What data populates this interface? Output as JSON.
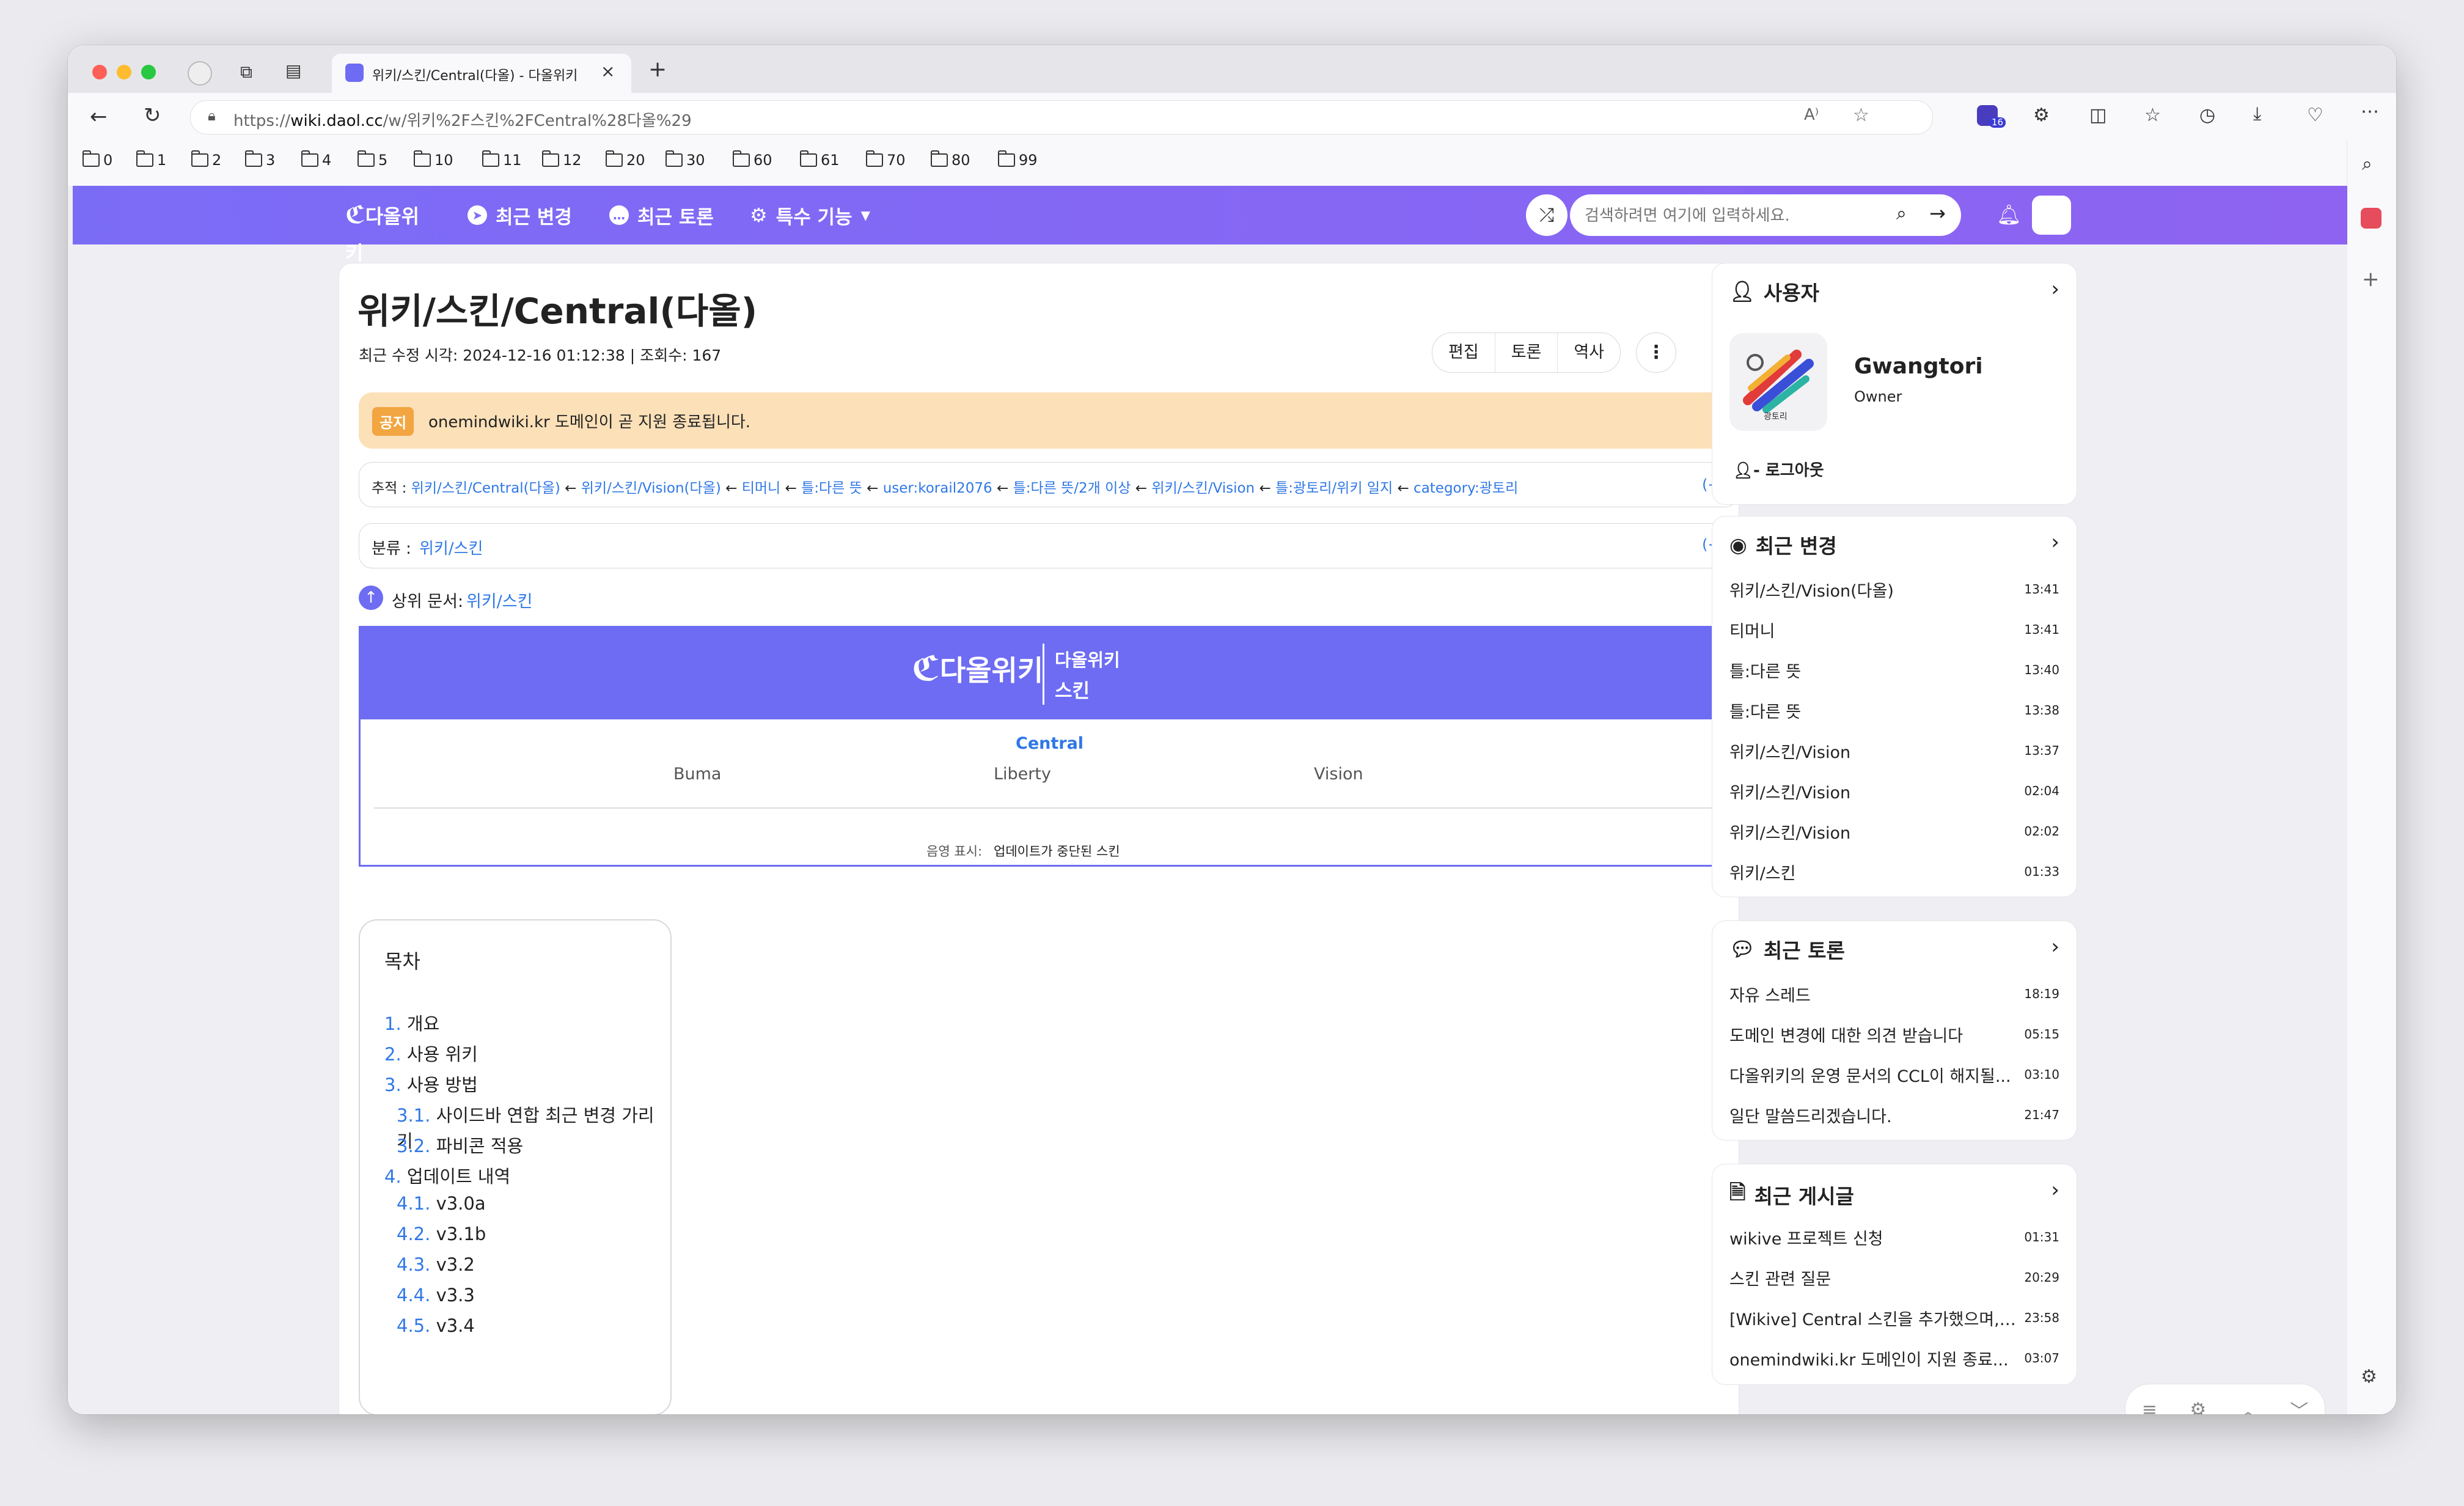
{
  "browser": {
    "tab_title": "위키/스킨/Central(다올) - 다올위키",
    "url_prefix": "https://",
    "url_host": "wiki.daol.cc",
    "url_path": "/w/위키%2F스킨%2FCentral%28다올%29",
    "extensions_badge": "16",
    "bookmarks": [
      "0",
      "1",
      "2",
      "3",
      "4",
      "5",
      "10",
      "11",
      "12",
      "20",
      "30",
      "60",
      "61",
      "70",
      "80",
      "99"
    ]
  },
  "site": {
    "logo_text": "다올위키",
    "nav": [
      "최근 변경",
      "최근 토론",
      "특수 기능"
    ],
    "search_placeholder": "검색하려면 여기에 입력하세요."
  },
  "article": {
    "title": "위키/스킨/Central(다올)",
    "meta": "최근 수정 시각: 2024-12-16 01:12:38 | 조회수: 167",
    "buttons": [
      "편집",
      "토론",
      "역사"
    ],
    "notice_badge": "공지",
    "notice_text": "onemindwiki.kr 도메인이 곧 지원 종료됩니다.",
    "trail_label": "추적 :",
    "trail": [
      "위키/스킨/Central(다올)",
      "위키/스킨/Vision(다올)",
      "티머니",
      "틀:다른 뜻",
      "user:korail2076",
      "틀:다른 뜻/2개 이상",
      "위키/스킨/Vision",
      "틀:광토리/위키 일지",
      "category:광토리"
    ],
    "trail_sep": "←",
    "plus": "(+)",
    "category_label": "분류 :",
    "category": "위키/스킨",
    "parent_label": "상위 문서:",
    "parent_link": "위키/스킨",
    "infobox": {
      "logo": "다올위키",
      "title_line1": "다올위키",
      "title_line2": "스킨",
      "current": "Central",
      "items": [
        "Buma",
        "Liberty",
        "Vision"
      ],
      "footer_label": "음영 표시:",
      "footer_text": "업데이트가 중단된 스킨"
    },
    "toc": {
      "title": "목차",
      "items": [
        {
          "num": "1.",
          "text": "개요"
        },
        {
          "num": "2.",
          "text": "사용 위키"
        },
        {
          "num": "3.",
          "text": "사용 방법"
        },
        {
          "num": "3.1.",
          "text": "사이드바 연합 최근 변경 가리기"
        },
        {
          "num": "3.2.",
          "text": "파비콘 적용"
        },
        {
          "num": "4.",
          "text": "업데이트 내역"
        },
        {
          "num": "4.1.",
          "text": "v3.0a"
        },
        {
          "num": "4.2.",
          "text": "v3.1b"
        },
        {
          "num": "4.3.",
          "text": "v3.2"
        },
        {
          "num": "4.4.",
          "text": "v3.3"
        },
        {
          "num": "4.5.",
          "text": "v3.4"
        }
      ]
    }
  },
  "sidebar": {
    "user": {
      "heading": "사용자",
      "name": "Gwangtori",
      "role": "Owner",
      "avatar_caption": "광토리",
      "logout": "로그아웃"
    },
    "recent_changes": {
      "heading": "최근 변경",
      "items": [
        {
          "t": "위키/스킨/Vision(다올)",
          "tm": "13:41"
        },
        {
          "t": "티머니",
          "tm": "13:41"
        },
        {
          "t": "틀:다른 뜻",
          "tm": "13:40"
        },
        {
          "t": "틀:다른 뜻",
          "tm": "13:38"
        },
        {
          "t": "위키/스킨/Vision",
          "tm": "13:37"
        },
        {
          "t": "위키/스킨/Vision",
          "tm": "02:04"
        },
        {
          "t": "위키/스킨/Vision",
          "tm": "02:02"
        },
        {
          "t": "위키/스킨",
          "tm": "01:33"
        }
      ]
    },
    "recent_discussions": {
      "heading": "최근 토론",
      "items": [
        {
          "t": "자유 스레드",
          "tm": "18:19"
        },
        {
          "t": "도메인 변경에 대한 의견 받습니다",
          "tm": "05:15"
        },
        {
          "t": "다올위키의 운영 문서의 CCL이 해지될...",
          "tm": "03:10"
        },
        {
          "t": "일단 말씀드리겠습니다.",
          "tm": "21:47"
        }
      ]
    },
    "recent_posts": {
      "heading": "최근 게시글",
      "items": [
        {
          "t": "wikive 프로젝트 신청",
          "tm": "01:31"
        },
        {
          "t": "스킨 관련 질문",
          "tm": "20:29"
        },
        {
          "t": "[Wikive] Central 스킨을 추가했으며, ...",
          "tm": "23:58"
        },
        {
          "t": "onemindwiki.kr 도메인이 지원 종료...",
          "tm": "03:07"
        }
      ]
    }
  },
  "colors": {
    "brand": "#7b6cf6",
    "link": "#2f78e6",
    "notice": "#fbe0b8"
  }
}
